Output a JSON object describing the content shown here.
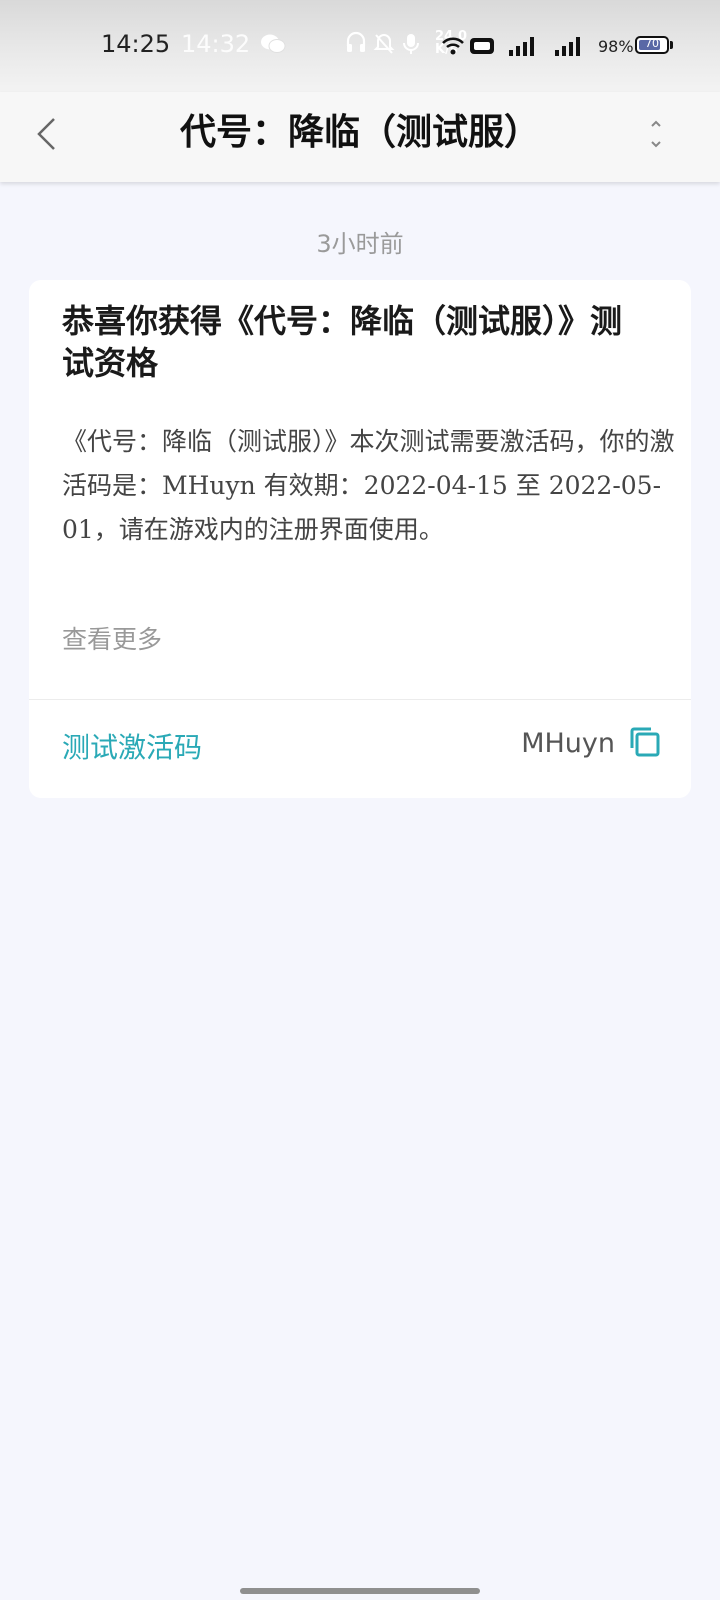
{
  "status_bar": {
    "time": "14:25",
    "time_overlay": "14:32",
    "network_speed": "24.0\nK/s",
    "battery_percent": "98%",
    "battery_level": "70",
    "icons": [
      "wechat-icon",
      "headset-icon",
      "bell-muted-icon",
      "microphone-icon",
      "wifi-icon",
      "hd-icon",
      "signal-icon",
      "4g-signal-icon",
      "battery-icon"
    ]
  },
  "header": {
    "title": "代号：降临（测试服）",
    "back_icon": "chevron-left-icon",
    "more_icon": "more-vertical-icon"
  },
  "message": {
    "timestamp": "3小时前",
    "title": "恭喜你获得《代号：降临（测试服）》测试资格",
    "body": "《代号：降临（测试服）》本次测试需要激活码，你的激活码是：MHuyn 有效期：2022-04-15 至 2022-05-01，请在游戏内的注册界面使用。",
    "see_more": "查看更多",
    "code_label": "测试激活码",
    "code_value": "MHuyn",
    "copy_icon": "copy-icon"
  },
  "colors": {
    "background": "#f5f6fd",
    "accent": "#2aa9b6",
    "card": "#ffffff"
  }
}
